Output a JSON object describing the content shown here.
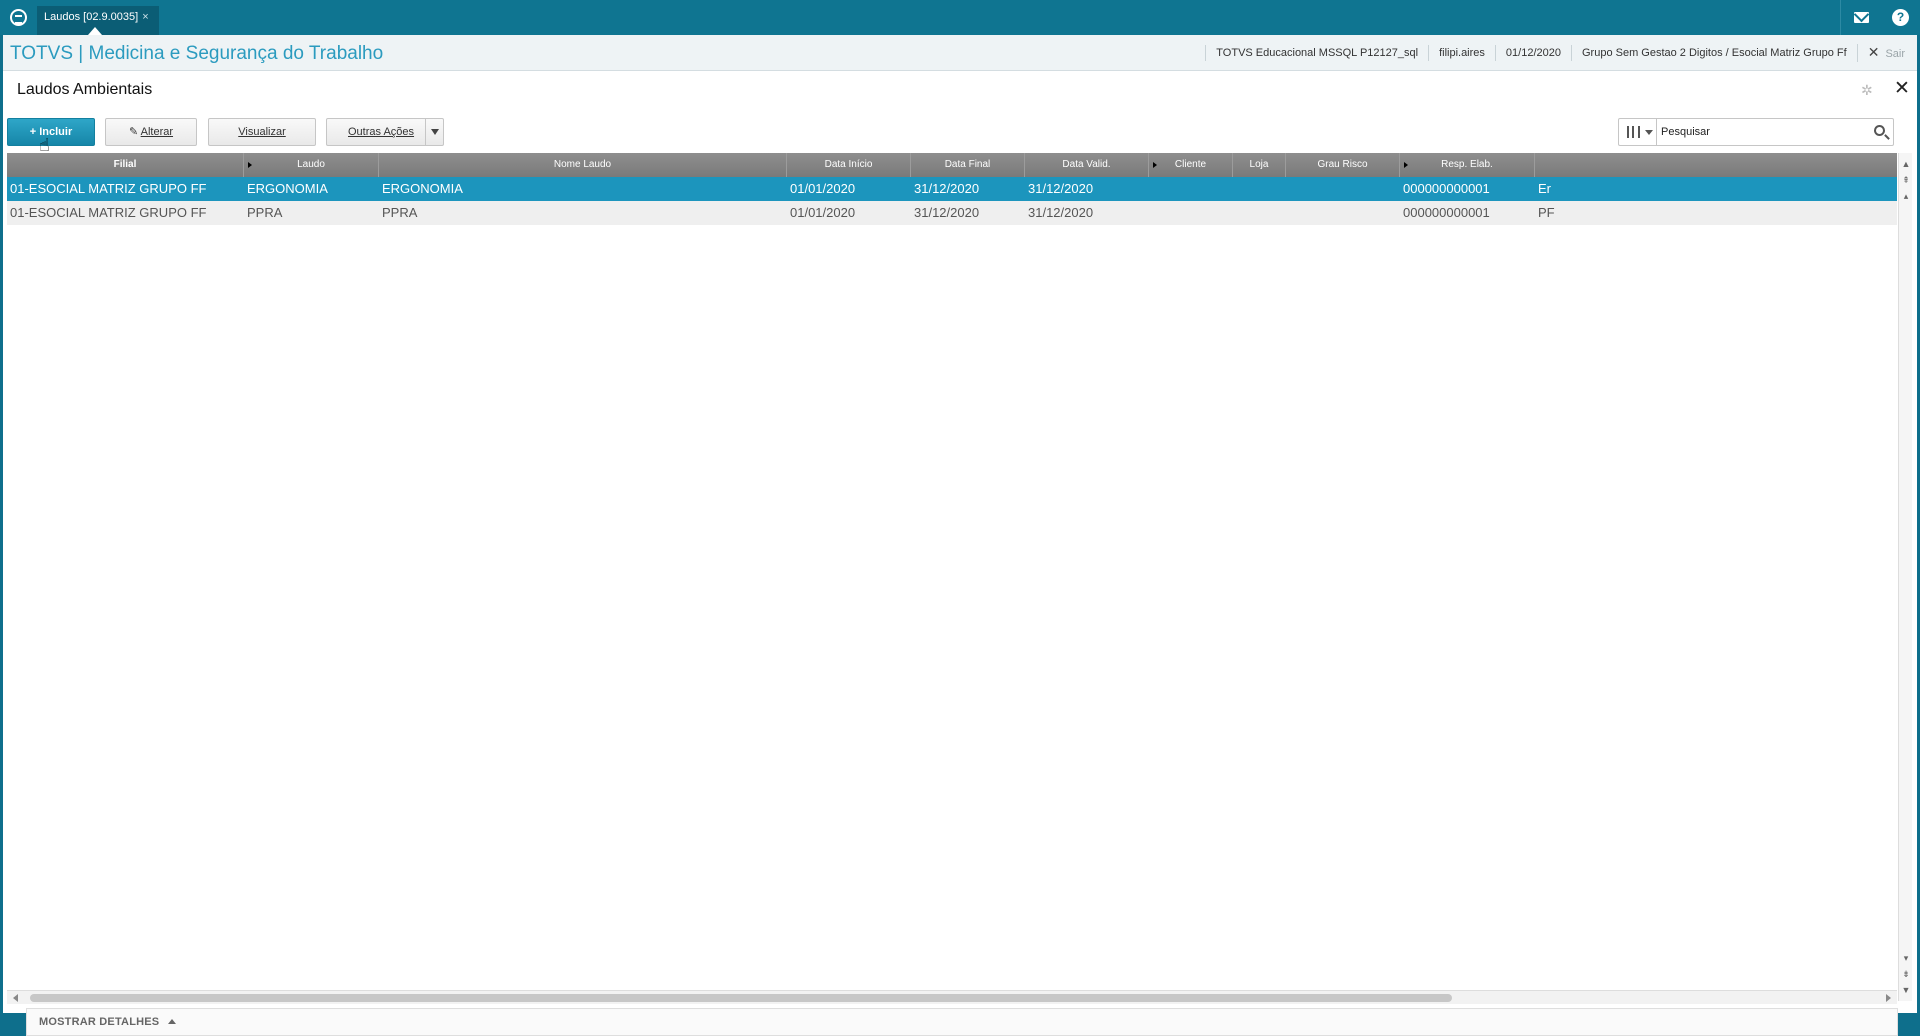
{
  "topbar": {
    "tab_label": "Laudos [02.9.0035]",
    "tab_close": "×"
  },
  "header": {
    "app_title": "TOTVS | Medicina e Segurança do Trabalho",
    "info": [
      "TOTVS Educacional MSSQL P12127_sql",
      "filipi.aires",
      "01/12/2020",
      "Grupo Sem Gestao 2 Digitos / Esocial Matriz Grupo Ff"
    ],
    "sair_label": "Sair"
  },
  "page": {
    "title": "Laudos Ambientais"
  },
  "toolbar": {
    "incluir_label": "Incluir",
    "alterar_label": "Alterar",
    "visualizar_label": "Visualizar",
    "outras_label": "Outras Ações"
  },
  "search": {
    "value": "Pesquisar"
  },
  "grid": {
    "columns": [
      "Filial",
      "Laudo",
      "Nome Laudo",
      "Data Início",
      "Data Final",
      "Data Valid.",
      "Cliente",
      "Loja",
      "Grau Risco",
      "Resp. Elab."
    ],
    "rows": [
      [
        "01-ESOCIAL MATRIZ GRUPO FF",
        "ERGONOMIA",
        "ERGONOMIA",
        "01/01/2020",
        "31/12/2020",
        "31/12/2020",
        "",
        "",
        "",
        "000000000001",
        "Er"
      ],
      [
        "01-ESOCIAL MATRIZ GRUPO FF",
        "PPRA",
        "PPRA",
        "01/01/2020",
        "31/12/2020",
        "31/12/2020",
        "",
        "",
        "",
        "000000000001",
        "PF"
      ]
    ]
  },
  "footer": {
    "label": "MOSTRAR DETALHES"
  },
  "colors": {
    "accent": "#0f7591",
    "selected_row": "#1c95bd",
    "title_blue": "#2b9bbf"
  }
}
